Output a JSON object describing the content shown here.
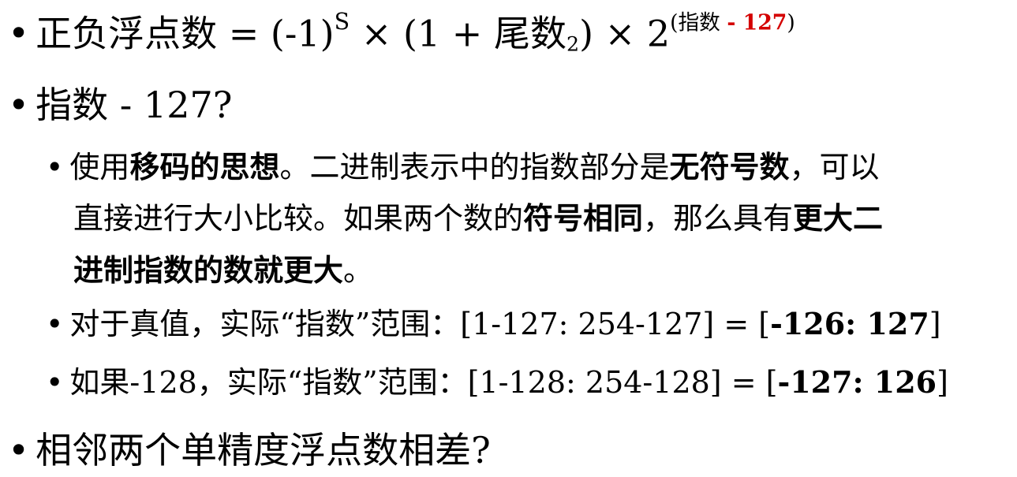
{
  "bullet": "•",
  "formula": {
    "lhs": "正负浮点数 = (-1)",
    "sign_sup": "S",
    "times1": " × (1 + 尾数",
    "base_sub": "2",
    "times2": ") × 2",
    "exp_open": "(指数 ",
    "exp_minus": "- 127",
    "exp_close": ")"
  },
  "q_exponent": "指数 - 127?",
  "explain": {
    "p1": "使用",
    "b1": "移码的思想",
    "p2": "。二进制表示中的指数部分是",
    "b2": "无符号数",
    "p3": "，可以",
    "p4": "直接进行大小比较。如果两个数的",
    "b3": "符号相同",
    "p5": "，那么具有",
    "b4": "更大二",
    "b5": "进制指数的数就更大",
    "p6": "。"
  },
  "range127": {
    "text": "对于真值，实际“指数”范围：[1-127: 254-127] = [",
    "bold": "-126: 127",
    "close": "]"
  },
  "range128": {
    "text": "如果-128，实际“指数”范围：[1-128: 254-128] = [",
    "bold": "-127: 126",
    "close": "]"
  },
  "q_adjacent": "相邻两个单精度浮点数相差?"
}
